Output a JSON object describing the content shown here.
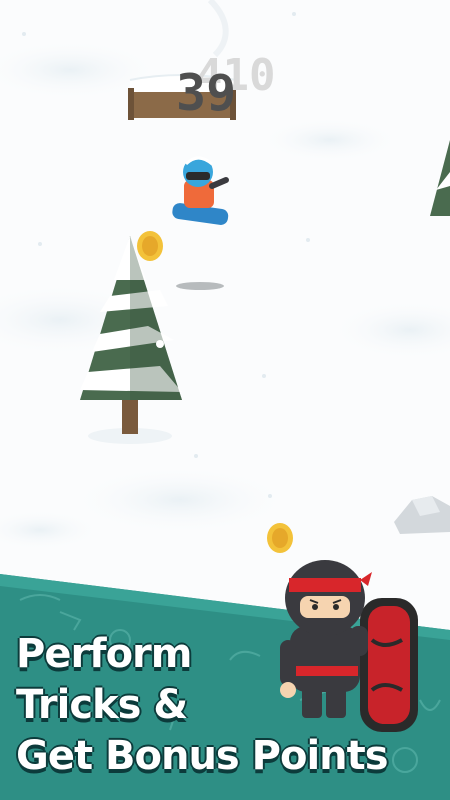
{
  "game": {
    "name": "snowboarding-endless-runner",
    "score_ghost": "410",
    "score": "39",
    "coins_visible": 2
  },
  "promo": {
    "line1": "Perform",
    "line2": "Tricks &",
    "line3": "Get Bonus Points"
  },
  "colors": {
    "snow": "#fbfcfd",
    "snow_shadow": "#e8f0f4",
    "tree_green": "#4a6b4f",
    "tree_dark": "#3a553f",
    "trunk": "#7a5a3c",
    "coin": "#f3c23a",
    "banner_teal": "#2e8f85",
    "banner_text": "#ffffff",
    "ninja_red": "#d8262b",
    "ninja_black": "#3a3a3f",
    "rider_helmet": "#39a6dc",
    "rider_board": "#2f86c8",
    "rider_body": "#ef6a3a",
    "score_gray": "#4f4f4f"
  },
  "icons": {
    "player": "snowboarder-character",
    "mascot": "ninja-with-snowboard",
    "collectible": "gold-coin"
  }
}
